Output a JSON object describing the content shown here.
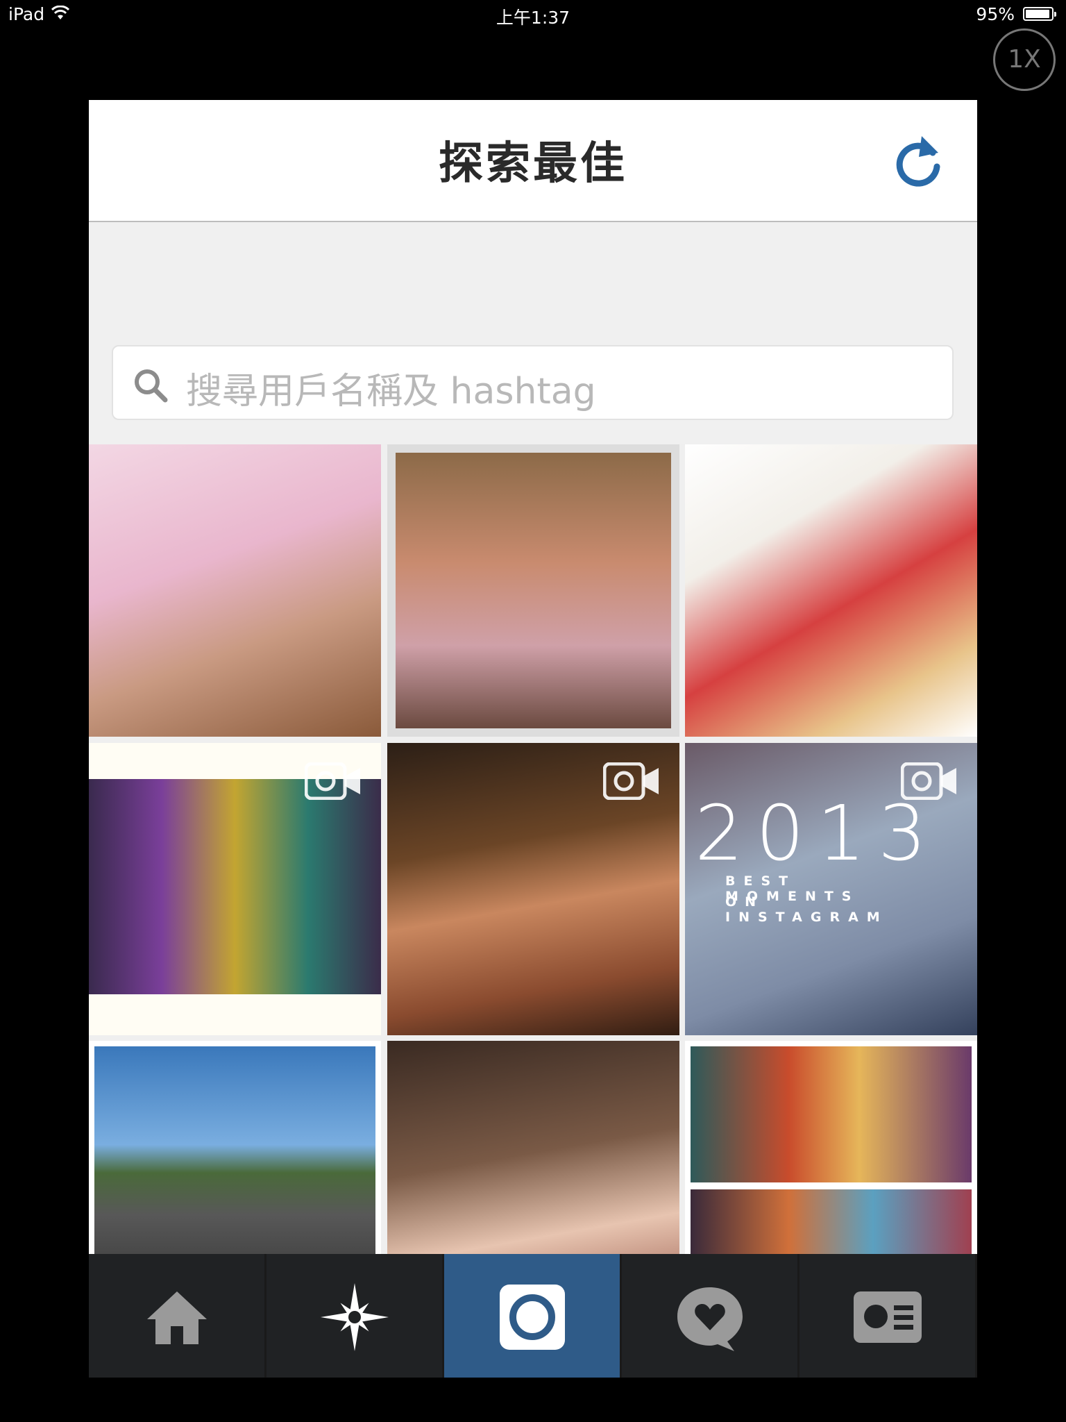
{
  "status_bar": {
    "device": "iPad",
    "time": "上午1:37",
    "battery": "95%"
  },
  "zoom_button": {
    "label": "1X"
  },
  "header": {
    "title": "探索最佳",
    "refresh_icon": "refresh-icon"
  },
  "search": {
    "placeholder": "搜尋用戶名稱及 hashtag",
    "icon": "search-icon"
  },
  "grid": {
    "video_icon": "video-camera-icon",
    "tile6_overlay": {
      "year": "2013",
      "line1": "BEST MOMENTS",
      "line2": "ON INSTAGRAM"
    }
  },
  "tab_bar": {
    "items": [
      {
        "icon": "home-icon",
        "active": false
      },
      {
        "icon": "explore-star-icon",
        "active": true
      },
      {
        "icon": "camera-icon",
        "active": false
      },
      {
        "icon": "news-heart-icon",
        "active": false
      },
      {
        "icon": "profile-card-icon",
        "active": false
      }
    ]
  },
  "colors": {
    "tab_active": "#2f5b88",
    "tab_bg": "#202224",
    "refresh_blue": "#2a6aa8"
  }
}
